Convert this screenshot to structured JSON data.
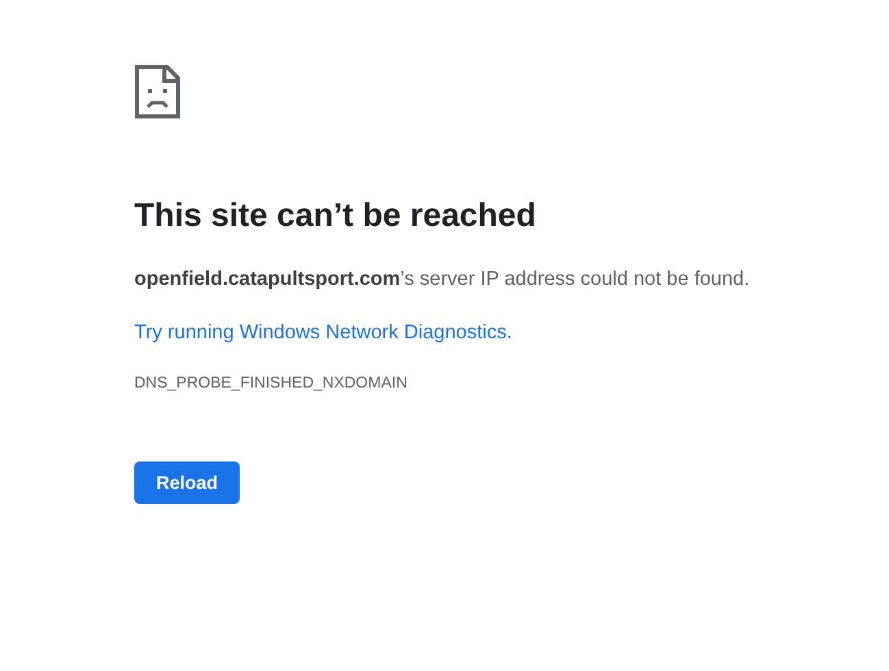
{
  "heading": "This site can’t be reached",
  "description": "**openfield.catapultsport.com**’s server IP address could not be found.",
  "suggestion": {
    "link": "Try running Windows Network Diagnostics",
    "after": "."
  },
  "error_code": "DNS_PROBE_FINISHED_NXDOMAIN",
  "buttons": [
    "Reload"
  ]
}
